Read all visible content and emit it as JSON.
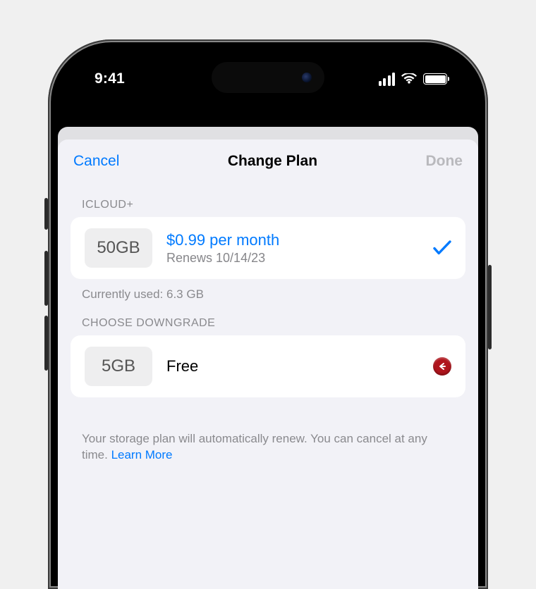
{
  "status": {
    "time": "9:41"
  },
  "nav": {
    "cancel": "Cancel",
    "title": "Change Plan",
    "done": "Done"
  },
  "sections": {
    "icloud_plus": {
      "header": "ICLOUD+",
      "plan": {
        "size": "50GB",
        "price": "$0.99 per month",
        "renews": "Renews 10/14/23"
      },
      "usage": "Currently used: 6.3 GB"
    },
    "downgrade": {
      "header": "CHOOSE DOWNGRADE",
      "plan": {
        "size": "5GB",
        "label": "Free"
      }
    }
  },
  "footer": {
    "text": "Your storage plan will automatically renew. You can cancel at any time. ",
    "link": "Learn More"
  }
}
